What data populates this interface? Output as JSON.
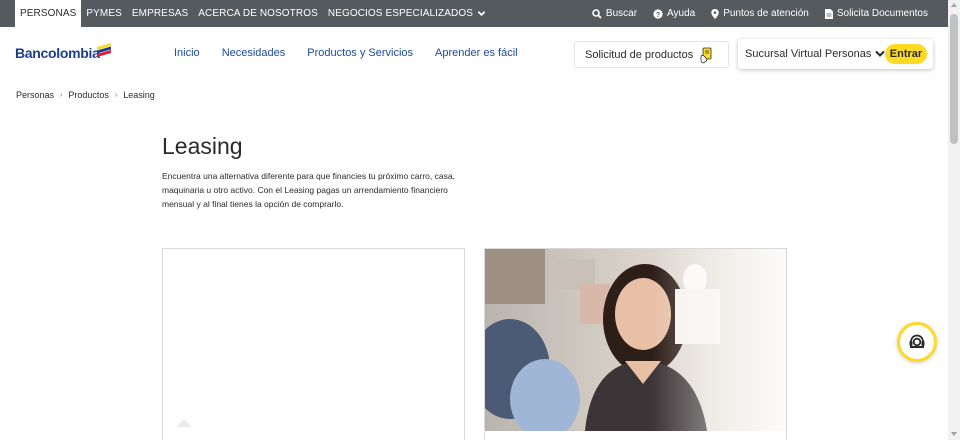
{
  "topbar": {
    "segments": [
      "PERSONAS",
      "PYMES",
      "EMPRESAS",
      "ACERCA DE NOSOTROS",
      "NEGOCIOS ESPECIALIZADOS"
    ],
    "utilities": {
      "search": "Buscar",
      "help": "Ayuda",
      "points": "Puntos de atención",
      "documents": "Solicita Documentos"
    }
  },
  "header": {
    "logo_text": "Bancolombia",
    "nav": [
      "Inicio",
      "Necesidades",
      "Productos y Servicios",
      "Aprender es fácil"
    ],
    "request_button": "Solicitud de productos",
    "virtual_branch": "Sucursal Virtual Personas",
    "enter_button": "Entrar"
  },
  "breadcrumb": [
    "Personas",
    "Productos",
    "Leasing"
  ],
  "main": {
    "title": "Leasing",
    "description": "Encuentra una alternativa diferente para que financies tu próximo carro, casa, maquinaria u otro activo. Con el Leasing pagas un arrendamiento financiero mensual y al final tienes la opción de comprarlo."
  },
  "colors": {
    "topbar": "#555a5f",
    "brand_blue": "#1b4b97",
    "brand_yellow": "#fdda24",
    "text": "#2c2a29"
  },
  "icons": {
    "search": "search-icon",
    "help": "question-circle-icon",
    "location": "map-pin-icon",
    "document": "document-icon",
    "request": "hand-card-icon",
    "chevron": "chevron-down-icon",
    "assistant": "assistant-headset-icon"
  }
}
